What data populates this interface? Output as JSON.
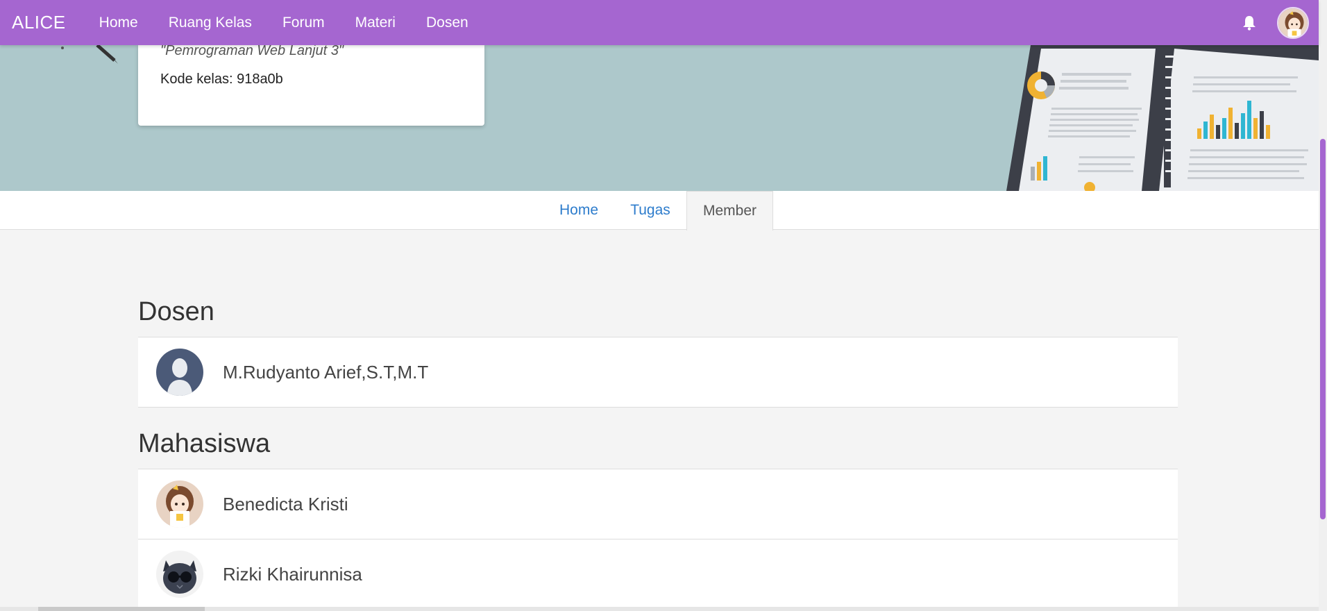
{
  "navbar": {
    "brand": "ALICE",
    "links": [
      "Home",
      "Ruang Kelas",
      "Forum",
      "Materi",
      "Dosen"
    ],
    "accent_color": "#a566d0",
    "icons": [
      "bell-icon",
      "user-avatar"
    ]
  },
  "class_card": {
    "name": "\"Pemrograman Web Lanjut 3\"",
    "code": "Kode kelas: 918a0b"
  },
  "tabs": [
    "Home",
    "Tugas",
    "Member"
  ],
  "active_tab": "Member",
  "sections": {
    "dosen_title": "Dosen",
    "mahasiswa_title": "Mahasiswa"
  },
  "dosen": [
    {
      "name": "M.Rudyanto Arief,S.T,M.T",
      "avatar": "default-person-avatar"
    }
  ],
  "mahasiswa": [
    {
      "name": "Benedicta Kristi",
      "avatar": "anime-girl-avatar"
    },
    {
      "name": "Rizki Khairunnisa",
      "avatar": "cat-sunglasses-avatar"
    }
  ]
}
